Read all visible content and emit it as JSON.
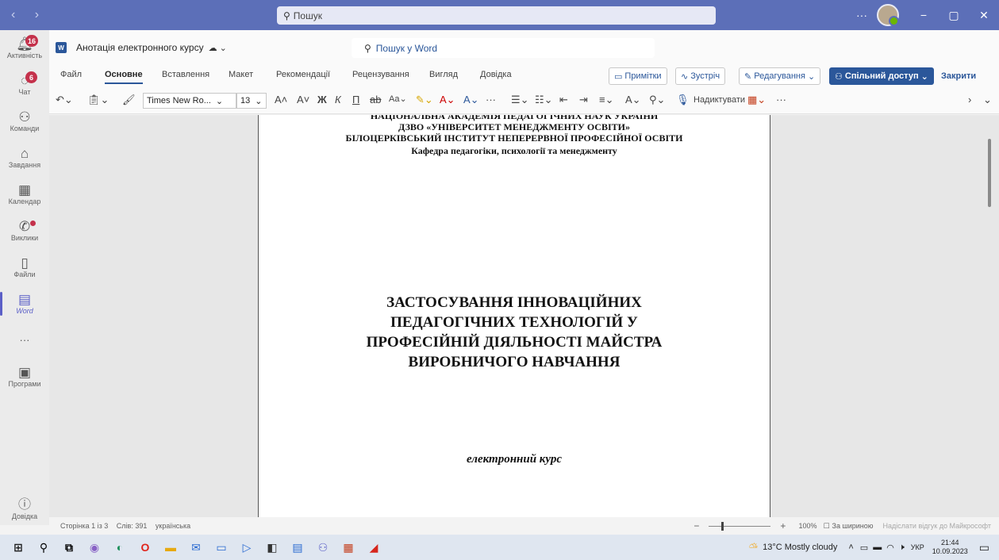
{
  "titlebar": {
    "search_placeholder": "Пошук",
    "more": "···",
    "minimize": "−",
    "maximize": "▢",
    "close": "✕"
  },
  "rail": {
    "items": [
      {
        "label": "Активність",
        "icon": "bell-icon",
        "badge": "16"
      },
      {
        "label": "Чат",
        "icon": "chat-icon",
        "badge": "6"
      },
      {
        "label": "Команди",
        "icon": "teams-icon"
      },
      {
        "label": "Завдання",
        "icon": "tasks-icon"
      },
      {
        "label": "Календар",
        "icon": "calendar-icon"
      },
      {
        "label": "Виклики",
        "icon": "phone-icon"
      },
      {
        "label": "Файли",
        "icon": "file-icon"
      },
      {
        "label": "Word",
        "icon": "word-icon"
      },
      {
        "label": "···",
        "icon": "more-icon"
      },
      {
        "label": "Програми",
        "icon": "apps-icon"
      }
    ],
    "help_label": "Довідка"
  },
  "document_bar": {
    "title": "Анотація електронного курсу",
    "search_placeholder": "Пошук у Word"
  },
  "ribbon": {
    "tabs": [
      "Файл",
      "Основне",
      "Вставлення",
      "Макет",
      "Рекомендації",
      "Рецензування",
      "Вигляд",
      "Довідка"
    ],
    "active_tab": "Основне",
    "comments_label": "Примітки",
    "meeting_label": "Зустріч",
    "editing_label": "Редагування",
    "share_label": "Спільний доступ",
    "close_label": "Закрити"
  },
  "toolbar": {
    "font_name": "Times New Ro...",
    "font_size": "13",
    "dictate_label": "Надиктувати"
  },
  "document": {
    "header_lines": [
      "НАЦІОНАЛЬНА АКАДЕМІЯ ПЕДАГОГІЧНИХ НАУК УКРАЇНИ",
      "ДЗВО «УНІВЕРСИТЕТ МЕНЕДЖМЕНТУ ОСВІТИ»",
      "БІЛОЦЕРКІВСЬКИЙ ІНСТИТУТ НЕПЕРЕРВНОЇ ПРОФЕСІЙНОЇ ОСВІТИ",
      "Кафедра педагогіки, психології та менеджменту"
    ],
    "title_lines": [
      "ЗАСТОСУВАННЯ ІННОВАЦІЙНИХ",
      "ПЕДАГОГІЧНИХ ТЕХНОЛОГІЙ У",
      "ПРОФЕСІЙНІЙ ДІЯЛЬНОСТІ МАЙСТРА",
      "ВИРОБНИЧОГО НАВЧАННЯ"
    ],
    "subtitle": "електронний курс"
  },
  "statusbar": {
    "page": "Сторінка 1 із 3",
    "words": "Слів: 391",
    "language": "українська",
    "zoom_minus": "−",
    "zoom_plus": "+",
    "zoom": "100%",
    "fit_width": "За шириною",
    "feedback": "Надіслати відгук до Майкрософт"
  },
  "taskbar": {
    "weather": "13°C  Mostly cloudy",
    "language": "УКР",
    "time": "21:44",
    "date": "10.09.2023"
  }
}
